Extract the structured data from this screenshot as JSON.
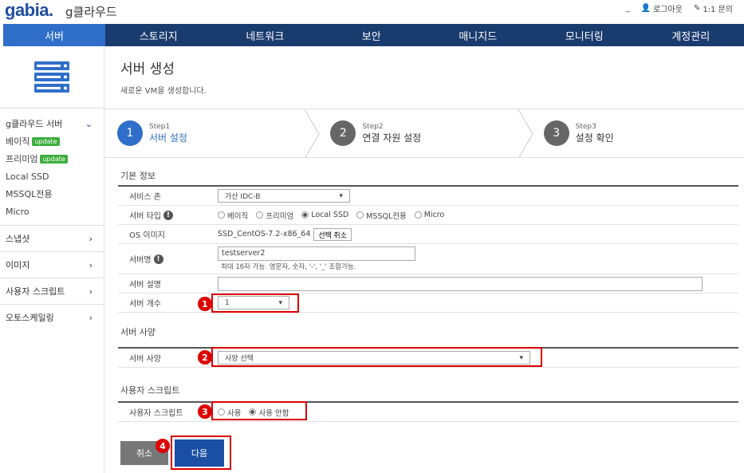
{
  "brand": {
    "logo": "gabia.",
    "product": "g클라우드"
  },
  "toplinks": {
    "minimize": "_",
    "logout": "로그아웃",
    "inquiry": "1:1 문의"
  },
  "nav": [
    "서버",
    "스토리지",
    "네트워크",
    "보안",
    "매니지드",
    "모니터링",
    "계정관리"
  ],
  "sidebar": {
    "group": "g클라우드 서버",
    "subs": [
      {
        "label": "베이직",
        "badge": "update"
      },
      {
        "label": "프리미엄",
        "badge": "update"
      },
      {
        "label": "Local SSD",
        "badge": ""
      },
      {
        "label": "MSSQL전용",
        "badge": ""
      },
      {
        "label": "Micro",
        "badge": ""
      }
    ],
    "menus": [
      "스냅샷",
      "이미지",
      "사용자 스크립트",
      "오토스케일링"
    ]
  },
  "header": {
    "title": "서버 생성",
    "desc": "새로운 VM을 생성합니다."
  },
  "steps": [
    {
      "num": "1",
      "step": "Step1",
      "label": "서버 설정"
    },
    {
      "num": "2",
      "step": "Step2",
      "label": "연결 자원 설정"
    },
    {
      "num": "3",
      "step": "Step3",
      "label": "설정 확인"
    }
  ],
  "basic": {
    "title": "기본 정보",
    "zone_label": "서비스 존",
    "zone_value": "가산 IDC-B",
    "type_label": "서버 타입",
    "types": [
      "베이직",
      "프리미엄",
      "Local SSD",
      "MSSQL전용",
      "Micro"
    ],
    "selected_type": "Local SSD",
    "os_label": "OS 이미지",
    "os_value": "SSD_CentOS-7.2-x86_64",
    "os_cancel": "선택 취소",
    "name_label": "서버명",
    "name_value": "testserver2",
    "name_hint": "최대 16자 가능. 영문자, 숫자, '-', '_' 조합가능.",
    "desc_label": "서버 설명",
    "desc_value": "",
    "count_label": "서버 개수",
    "count_value": "1"
  },
  "spec": {
    "title": "서버 사양",
    "label": "서버 사양",
    "value": "사양 선택"
  },
  "script": {
    "title": "사용자 스크립트",
    "label": "사용자 스크립트",
    "opt_use": "사용",
    "opt_nouse": "사용 안함",
    "selected": "사용 안함"
  },
  "annotations": [
    "1",
    "2",
    "3",
    "4"
  ],
  "buttons": {
    "cancel": "취소",
    "next": "다음"
  },
  "colors": {
    "nav": "#1a3b6e",
    "nav_active": "#2f6fc9",
    "annotation": "#dd0000",
    "next": "#1a4fa3",
    "badge": "#3cae3c"
  }
}
